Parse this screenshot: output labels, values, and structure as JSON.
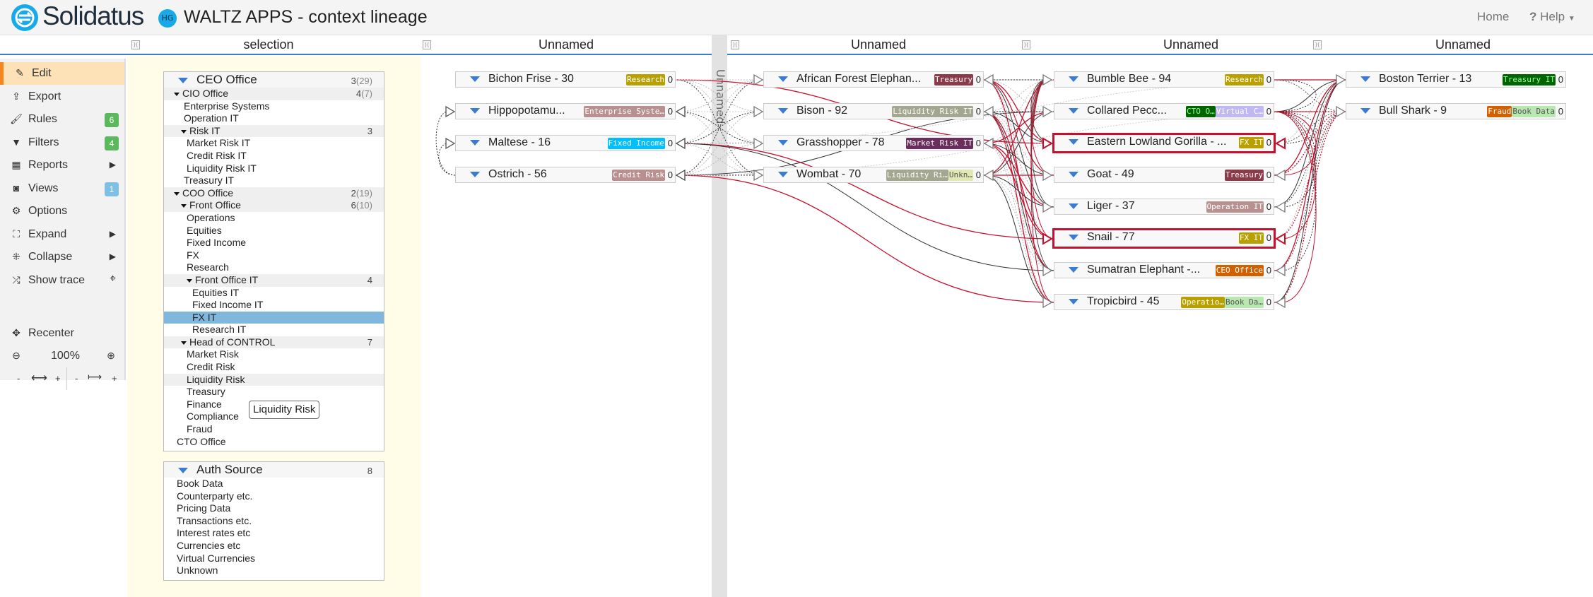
{
  "header": {
    "brand": "Solidatus",
    "user_initials": "HG",
    "title": "WALTZ APPS - context lineage",
    "nav": {
      "home": "Home",
      "help": "Help"
    }
  },
  "columns": [
    "selection",
    "Unnamed",
    "Unnamed",
    "Unnamed",
    "Unnamed"
  ],
  "divider_label": "Unnamed",
  "sidebar": {
    "items": [
      {
        "label": "Edit",
        "icon": "pencil-icon",
        "active": true
      },
      {
        "label": "Export",
        "icon": "upload-icon"
      },
      {
        "label": "Rules",
        "icon": "brush-icon",
        "badge": "6",
        "badge_color": "#5cb85c"
      },
      {
        "label": "Filters",
        "icon": "filter-icon",
        "badge": "4",
        "badge_color": "#5cb85c"
      },
      {
        "label": "Reports",
        "icon": "table-icon",
        "submenu": true
      },
      {
        "label": "Views",
        "icon": "camera-icon",
        "badge": "1",
        "badge_color": "#7fbfe6"
      },
      {
        "label": "Options",
        "icon": "gear-icon"
      },
      {
        "label": "Expand",
        "icon": "expand-icon",
        "submenu": true
      },
      {
        "label": "Collapse",
        "icon": "collapse-icon",
        "submenu": true
      },
      {
        "label": "Show trace",
        "icon": "shuffle-icon",
        "extra": "crosshair-icon"
      }
    ],
    "recenter": "Recenter",
    "zoom": "100%"
  },
  "tree": {
    "title": "CEO Office",
    "count": "3",
    "sub": "(29)",
    "rows": [
      {
        "l": "CIO Office",
        "lvl": 1,
        "caret": true,
        "g": true,
        "count": "4",
        "sub": "(7)"
      },
      {
        "l": "Enterprise Systems",
        "lvl": 2
      },
      {
        "l": "Operation IT",
        "lvl": 2
      },
      {
        "l": "Risk IT",
        "lvl": 2,
        "caret": true,
        "g": true,
        "count": "3"
      },
      {
        "l": "Market Risk IT",
        "lvl": 3
      },
      {
        "l": "Credit Risk IT",
        "lvl": 3
      },
      {
        "l": "Liquidity Risk IT",
        "lvl": 3
      },
      {
        "l": "Treasury IT",
        "lvl": 2
      },
      {
        "l": "COO Office",
        "lvl": 1,
        "caret": true,
        "g": true,
        "count": "2",
        "sub": "(19)"
      },
      {
        "l": "Front Office",
        "lvl": 2,
        "caret": true,
        "g": true,
        "count": "6",
        "sub": "(10)"
      },
      {
        "l": "Operations",
        "lvl": 3
      },
      {
        "l": "Equities",
        "lvl": 3
      },
      {
        "l": "Fixed Income",
        "lvl": 3
      },
      {
        "l": "FX",
        "lvl": 3
      },
      {
        "l": "Research",
        "lvl": 3
      },
      {
        "l": "Front Office IT",
        "lvl": 3,
        "caret": true,
        "g": true,
        "count": "4"
      },
      {
        "l": "Equities IT",
        "lvl": 4
      },
      {
        "l": "Fixed Income IT",
        "lvl": 4
      },
      {
        "l": "FX IT",
        "lvl": 4,
        "sel": true
      },
      {
        "l": "Research IT",
        "lvl": 4
      },
      {
        "l": "Head of CONTROL",
        "lvl": 2,
        "caret": true,
        "g": true,
        "count": "7"
      },
      {
        "l": "Market Risk",
        "lvl": 3
      },
      {
        "l": "Credit Risk",
        "lvl": 3
      },
      {
        "l": "Liquidity Risk",
        "lvl": 3,
        "g": true
      },
      {
        "l": "Treasury",
        "lvl": 3
      },
      {
        "l": "Finance",
        "lvl": 3
      },
      {
        "l": "Compliance",
        "lvl": 3
      },
      {
        "l": "Fraud",
        "lvl": 3
      },
      {
        "l": "CTO Office",
        "lvl": 1.5
      }
    ]
  },
  "tooltip": "Liquidity Risk",
  "auth": {
    "title": "Auth Source",
    "count": "8",
    "rows": [
      "Book Data",
      "Counterparty etc.",
      "Pricing Data",
      "Transactions etc.",
      "Interest rates etc",
      "Currencies etc",
      "Virtual Currencies",
      "Unknown"
    ]
  },
  "graph": [
    [
      {
        "name": "Bichon Frise - 30",
        "tags": [
          {
            "t": "Research",
            "bg": "#b8a000",
            "fg": "#fff"
          }
        ],
        "count": "0"
      },
      {
        "name": "Hippopotamu...",
        "tags": [
          {
            "t": "Enterprise Syste…",
            "bg": "#b89090",
            "fg": "#fff"
          }
        ],
        "count": "0"
      },
      {
        "name": "Maltese - 16",
        "tags": [
          {
            "t": "Fixed Income",
            "bg": "#00bfff",
            "fg": "#fff"
          }
        ],
        "count": "0"
      },
      {
        "name": "Ostrich - 56",
        "tags": [
          {
            "t": "Credit Risk",
            "bg": "#b89090",
            "fg": "#fff"
          }
        ],
        "count": "0"
      }
    ],
    [
      {
        "name": "African Forest Elephan...",
        "tags": [
          {
            "t": "Treasury",
            "bg": "#8b3a4a",
            "fg": "#fff"
          }
        ],
        "count": "0"
      },
      {
        "name": "Bison - 92",
        "tags": [
          {
            "t": "Liquidity Risk IT",
            "bg": "#a3a78f",
            "fg": "#fff"
          }
        ],
        "count": "0"
      },
      {
        "name": "Grasshopper - 78",
        "tags": [
          {
            "t": "Market Risk IT",
            "bg": "#6b2d5c",
            "fg": "#fff"
          }
        ],
        "count": "0"
      },
      {
        "name": "Wombat - 70",
        "tags": [
          {
            "t": "Liquidity Ri…",
            "bg": "#a3a78f",
            "fg": "#fff"
          },
          {
            "t": "Unkn…",
            "bg": "#e2e8b4",
            "fg": "#555"
          }
        ],
        "count": "0"
      }
    ],
    [
      {
        "name": "Bumble Bee - 94",
        "tags": [
          {
            "t": "Research",
            "bg": "#b8a000",
            "fg": "#fff"
          }
        ],
        "count": "0"
      },
      {
        "name": "Collared Pecc...",
        "tags": [
          {
            "t": "CTO O…",
            "bg": "#006400",
            "fg": "#9f9"
          },
          {
            "t": "Virtual C…",
            "bg": "#c0b8f0",
            "fg": "#fff"
          }
        ],
        "count": "0"
      },
      {
        "name": "Eastern Lowland Gorilla - ...",
        "tags": [
          {
            "t": "FX IT",
            "bg": "#b8a000",
            "fg": "#fff"
          }
        ],
        "count": "0",
        "highlight": true
      },
      {
        "name": "Goat - 49",
        "tags": [
          {
            "t": "Treasury",
            "bg": "#8b3a4a",
            "fg": "#fff"
          }
        ],
        "count": "0"
      },
      {
        "name": "Liger - 37",
        "tags": [
          {
            "t": "Operation IT",
            "bg": "#b89090",
            "fg": "#fff"
          }
        ],
        "count": "0"
      },
      {
        "name": "Snail - 77",
        "tags": [
          {
            "t": "FX IT",
            "bg": "#b8a000",
            "fg": "#fff"
          }
        ],
        "count": "0",
        "highlight": true
      },
      {
        "name": "Sumatran Elephant -...",
        "tags": [
          {
            "t": "CEO Office",
            "bg": "#d06000",
            "fg": "#fff"
          }
        ],
        "count": "0"
      },
      {
        "name": "Tropicbird - 45",
        "tags": [
          {
            "t": "Operatio…",
            "bg": "#b8a000",
            "fg": "#fff"
          },
          {
            "t": "Book Da…",
            "bg": "#b8e8b0",
            "fg": "#555"
          }
        ],
        "count": "0"
      }
    ],
    [
      {
        "name": "Boston Terrier - 13",
        "tags": [
          {
            "t": "Treasury IT",
            "bg": "#006400",
            "fg": "#9f9"
          }
        ],
        "count": "0"
      },
      {
        "name": "Bull Shark - 9",
        "tags": [
          {
            "t": "Fraud",
            "bg": "#d06000",
            "fg": "#fff"
          },
          {
            "t": "Book Data",
            "bg": "#b8e8b0",
            "fg": "#555"
          }
        ],
        "count": "0"
      }
    ]
  ]
}
